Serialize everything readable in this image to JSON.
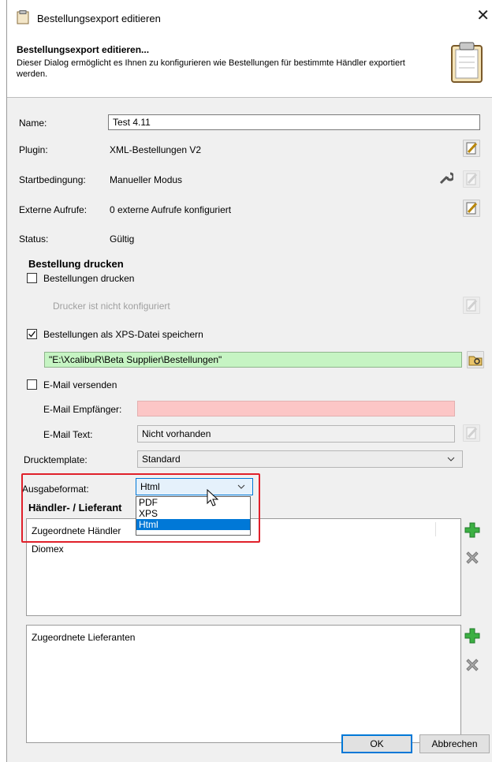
{
  "window": {
    "title": "Bestellungsexport editieren",
    "close_glyph": "✕"
  },
  "header": {
    "title": "Bestellungsexport editieren...",
    "description": "Dieser Dialog ermöglicht es Ihnen zu konfigurieren wie Bestellungen für bestimmte Händler exportiert werden."
  },
  "form": {
    "name_label": "Name:",
    "name_value": "Test 4.11",
    "plugin_label": "Plugin:",
    "plugin_value": "XML-Bestellungen V2",
    "start_label": "Startbedingung:",
    "start_value": "Manueller Modus",
    "external_label": "Externe Aufrufe:",
    "external_value": "0 externe Aufrufe konfiguriert",
    "status_label": "Status:",
    "status_value": "Gültig"
  },
  "print": {
    "section_title": "Bestellung drucken",
    "print_checkbox_label": "Bestellungen drucken",
    "print_checked": false,
    "printer_status": "Drucker ist nicht konfiguriert",
    "xps_checkbox_label": "Bestellungen als XPS-Datei speichern",
    "xps_checked": true,
    "xps_path": "\"E:\\XcalibuR\\Beta Supplier\\Bestellungen\"",
    "email_checkbox_label": "E-Mail versenden",
    "email_checked": false,
    "email_recipient_label": "E-Mail Empfänger:",
    "email_recipient_value": "",
    "email_text_label": "E-Mail Text:",
    "email_text_value": "Nicht vorhanden",
    "template_label": "Drucktemplate:",
    "template_value": "Standard",
    "format_label": "Ausgabeformat:",
    "format_value": "Html",
    "format_options": [
      "PDF",
      "XPS",
      "Html"
    ]
  },
  "assignment": {
    "section_title": "Händler- / Lieferant",
    "dealers_header": "Zugeordnete Händler",
    "dealers": [
      "Diomex"
    ],
    "suppliers_header": "Zugeordnete Lieferanten",
    "suppliers": []
  },
  "buttons": {
    "ok": "OK",
    "cancel": "Abbrechen"
  },
  "colors": {
    "green_field": "#c6f4c3",
    "pink_field": "#fcc6c6",
    "highlight": "#e0202a",
    "selection": "#0078d7"
  }
}
